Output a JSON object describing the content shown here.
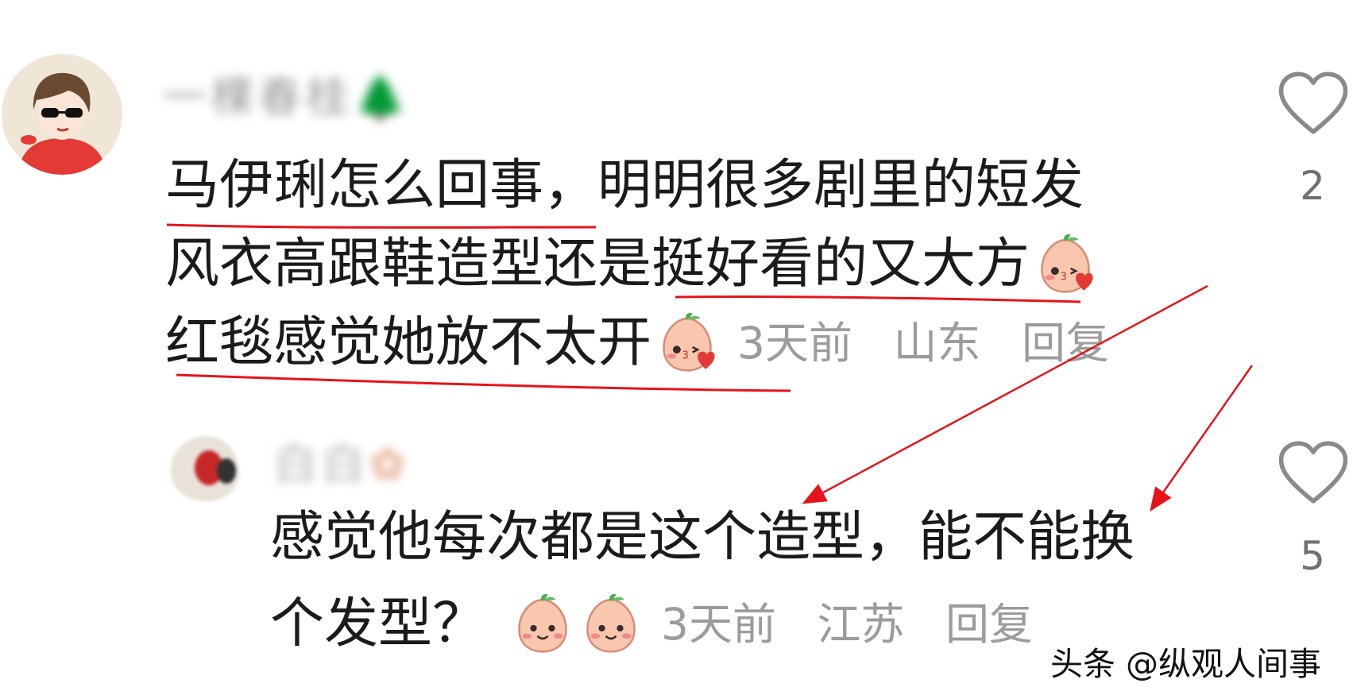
{
  "comment": {
    "username": "一棵春桂",
    "name_emoji": "🌲",
    "text_lines": [
      "马伊琍怎么回事，明明很多剧里的短发",
      "风衣高跟鞋造型还是挺好看的又大方",
      "红毯感觉她放不太开"
    ],
    "time": "3天前",
    "location": "山东",
    "reply_label": "回复",
    "like_count": "2"
  },
  "reply": {
    "username": "白白",
    "text_lines": [
      "感觉他每次都是这个造型，能不能换",
      "个发型？"
    ],
    "time": "3天前",
    "location": "江苏",
    "reply_label": "回复",
    "like_count": "5"
  },
  "watermark": "头条 @纵观人间事",
  "colors": {
    "annotation": "#e5141b",
    "meta_text": "#9c9c9c",
    "emoji_face": "#f8c0a8",
    "emoji_leaf": "#4caf50"
  },
  "icons": {
    "like": "heart-outline-icon",
    "sticker": "peach-kiss-sticker-icon",
    "sticker_smile": "peach-smile-sticker-icon"
  }
}
